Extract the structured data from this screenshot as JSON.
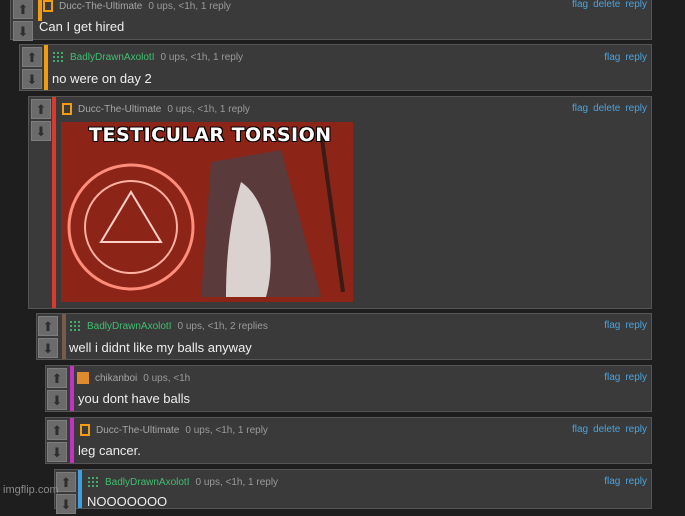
{
  "comments": [
    {
      "user": "Ducc-The-Ultimate",
      "meta": "0 ups, <1h, 1 reply",
      "text": "Can I get hired",
      "actions": [
        "flag",
        "delete",
        "reply"
      ],
      "accent": "#f39c12"
    },
    {
      "user": "BadlyDrawnAxolotI",
      "meta": "0 ups, <1h, 1 reply",
      "text": "no were on day 2",
      "actions": [
        "flag",
        "reply"
      ],
      "accent": "#f39c12"
    },
    {
      "user": "Ducc-The-Ultimate",
      "meta": "0 ups, <1h, 1 reply",
      "text": "",
      "meme_caption": "TESTICULAR TORSION",
      "actions": [
        "flag",
        "delete",
        "reply"
      ],
      "accent": "#d93a2b"
    },
    {
      "user": "BadlyDrawnAxolotI",
      "meta": "0 ups, <1h, 2 replies",
      "text": "well i didnt like my balls anyway",
      "actions": [
        "flag",
        "reply"
      ],
      "accent": "#7a5a4a"
    },
    {
      "user": "chikanboi",
      "meta": "0 ups, <1h",
      "text": "you dont have balls",
      "actions": [
        "flag",
        "reply"
      ],
      "accent": "#c233c2"
    },
    {
      "user": "Ducc-The-Ultimate",
      "meta": "0 ups, <1h, 1 reply",
      "text": "leg cancer.",
      "actions": [
        "flag",
        "delete",
        "reply"
      ],
      "accent": "#c233c2"
    },
    {
      "user": "BadlyDrawnAxolotI",
      "meta": "0 ups, <1h, 1 reply",
      "text": "NOOOOOOO",
      "actions": [
        "flag",
        "reply"
      ],
      "accent": "#3aa0e0"
    }
  ],
  "watermark": "imgflip.com",
  "colors": {
    "link": "#4aa3df",
    "user_orange": "#9aa0a6",
    "user_green": "#3fbf6f"
  }
}
